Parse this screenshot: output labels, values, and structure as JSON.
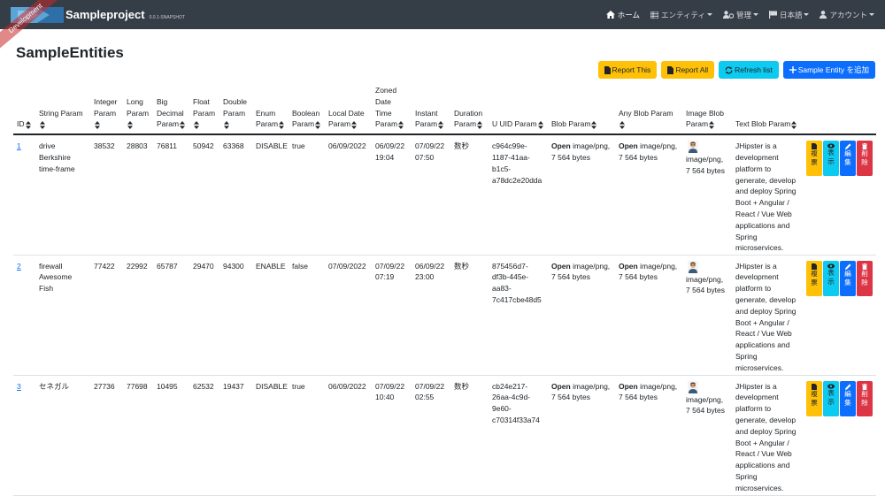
{
  "navbar": {
    "dev_ribbon": "Development",
    "brand_title": "Sampleproject",
    "brand_version": "0.0.1-SNAPSHOT",
    "items": [
      {
        "label": "ホーム",
        "icon": "home-icon",
        "dropdown": false
      },
      {
        "label": "エンティティ",
        "icon": "list-icon",
        "dropdown": true
      },
      {
        "label": "管理",
        "icon": "users-cog-icon",
        "dropdown": true
      },
      {
        "label": "日本語",
        "icon": "flag-icon",
        "dropdown": true
      },
      {
        "label": "アカウント",
        "icon": "user-icon",
        "dropdown": true
      }
    ]
  },
  "page": {
    "title": "SampleEntities",
    "buttons": {
      "report_this": "Report This",
      "report_all": "Report All",
      "refresh": "Refresh list",
      "add": "Sample Entity を追加"
    }
  },
  "table": {
    "headers": [
      [
        "ID"
      ],
      [
        "String Param"
      ],
      [
        "Integer",
        "Param"
      ],
      [
        "Long",
        "Param"
      ],
      [
        "Big",
        "Decimal",
        "Param"
      ],
      [
        "Float",
        "Param"
      ],
      [
        "Double",
        "Param"
      ],
      [
        "Enum",
        "Param"
      ],
      [
        "Boolean",
        "Param"
      ],
      [
        "Local Date",
        "Param"
      ],
      [
        "Zoned",
        "Date",
        "Time",
        "Param"
      ],
      [
        "Instant",
        "Param"
      ],
      [
        "Duration",
        "Param"
      ],
      [
        "U UID Param"
      ],
      [
        "Blob Param"
      ],
      [
        "Any Blob Param"
      ],
      [
        "Image Blob",
        "Param"
      ],
      [
        "Text Blob Param"
      ],
      [
        ""
      ]
    ],
    "open_label": "Open",
    "rows": [
      {
        "id": "1",
        "string": [
          "drive",
          "Berkshire",
          "time-frame"
        ],
        "integer": "38532",
        "long": "28803",
        "bigdecimal": "76811",
        "float": "50942",
        "double": "63368",
        "enum": "DISABLE",
        "boolean": "true",
        "localdate": "06/09/2022",
        "zoned": [
          "06/09/22",
          "19:04"
        ],
        "instant": [
          "07/09/22",
          "07:50"
        ],
        "duration": "数秒",
        "uuid": [
          "c964c99e-",
          "1187-41aa-",
          "b1c5-",
          "a78dc2e20dda"
        ],
        "blob": [
          "image/png,",
          "7 564 bytes"
        ],
        "anyblob": [
          "image/png,",
          "7 564 bytes"
        ],
        "imageblob": [
          "image/png,",
          "7 564 bytes"
        ],
        "text": [
          "JHipster is a",
          "development",
          "platform to",
          "generate, develop",
          "and deploy Spring",
          "Boot + Angular /",
          "React / Vue Web",
          "applications and",
          "Spring",
          "microservices."
        ]
      },
      {
        "id": "2",
        "string": [
          "firewall",
          "Awesome",
          "Fish"
        ],
        "integer": "77422",
        "long": "22992",
        "bigdecimal": "65787",
        "float": "29470",
        "double": "94300",
        "enum": "ENABLE",
        "boolean": "false",
        "localdate": "07/09/2022",
        "zoned": [
          "07/09/22",
          "07:19"
        ],
        "instant": [
          "06/09/22",
          "23:00"
        ],
        "duration": "数秒",
        "uuid": [
          "875456d7-",
          "df3b-445e-",
          "aa83-",
          "7c417cbe48d5"
        ],
        "blob": [
          "image/png,",
          "7 564 bytes"
        ],
        "anyblob": [
          "image/png,",
          "7 564 bytes"
        ],
        "imageblob": [
          "image/png,",
          "7 564 bytes"
        ],
        "text": [
          "JHipster is a",
          "development",
          "platform to",
          "generate, develop",
          "and deploy Spring",
          "Boot + Angular /",
          "React / Vue Web",
          "applications and",
          "Spring",
          "microservices."
        ]
      },
      {
        "id": "3",
        "string": [
          "セネガル"
        ],
        "integer": "27736",
        "long": "77698",
        "bigdecimal": "10495",
        "float": "62532",
        "double": "19437",
        "enum": "DISABLE",
        "boolean": "true",
        "localdate": "06/09/2022",
        "zoned": [
          "07/09/22",
          "10:40"
        ],
        "instant": [
          "07/09/22",
          "02:55"
        ],
        "duration": "数秒",
        "uuid": [
          "cb24e217-",
          "26aa-4c9d-",
          "9e60-",
          "c70314f33a74"
        ],
        "blob": [
          "image/png,",
          "7 564 bytes"
        ],
        "anyblob": [
          "image/png,",
          "7 564 bytes"
        ],
        "imageblob": [
          "image/png,",
          "7 564 bytes"
        ],
        "text": [
          "JHipster is a",
          "development",
          "platform to",
          "generate, develop",
          "and deploy Spring",
          "Boot + Angular /",
          "React / Vue Web",
          "applications and",
          "Spring",
          "microservices."
        ]
      }
    ],
    "actions": [
      {
        "label": [
          "複",
          "票"
        ],
        "icon": "file-icon",
        "color": "#ffc107"
      },
      {
        "label": [
          "表",
          "示"
        ],
        "icon": "eye-icon",
        "color": "#0dcaf0"
      },
      {
        "label": [
          "編",
          "集"
        ],
        "icon": "pencil-icon",
        "color": "#0d6efd"
      },
      {
        "label": [
          "削",
          "除"
        ],
        "icon": "trash-icon",
        "color": "#dc3545"
      }
    ]
  }
}
